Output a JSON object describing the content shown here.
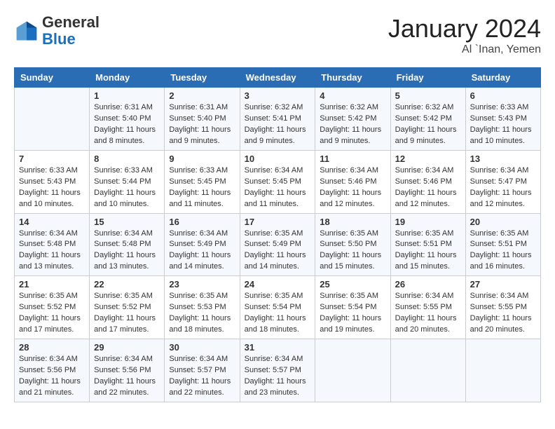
{
  "header": {
    "logo_general": "General",
    "logo_blue": "Blue",
    "month": "January 2024",
    "location": "Al `Inan, Yemen"
  },
  "columns": [
    "Sunday",
    "Monday",
    "Tuesday",
    "Wednesday",
    "Thursday",
    "Friday",
    "Saturday"
  ],
  "weeks": [
    [
      {
        "day": "",
        "info": ""
      },
      {
        "day": "1",
        "info": "Sunrise: 6:31 AM\nSunset: 5:40 PM\nDaylight: 11 hours\nand 8 minutes."
      },
      {
        "day": "2",
        "info": "Sunrise: 6:31 AM\nSunset: 5:40 PM\nDaylight: 11 hours\nand 9 minutes."
      },
      {
        "day": "3",
        "info": "Sunrise: 6:32 AM\nSunset: 5:41 PM\nDaylight: 11 hours\nand 9 minutes."
      },
      {
        "day": "4",
        "info": "Sunrise: 6:32 AM\nSunset: 5:42 PM\nDaylight: 11 hours\nand 9 minutes."
      },
      {
        "day": "5",
        "info": "Sunrise: 6:32 AM\nSunset: 5:42 PM\nDaylight: 11 hours\nand 9 minutes."
      },
      {
        "day": "6",
        "info": "Sunrise: 6:33 AM\nSunset: 5:43 PM\nDaylight: 11 hours\nand 10 minutes."
      }
    ],
    [
      {
        "day": "7",
        "info": "Sunrise: 6:33 AM\nSunset: 5:43 PM\nDaylight: 11 hours\nand 10 minutes."
      },
      {
        "day": "8",
        "info": "Sunrise: 6:33 AM\nSunset: 5:44 PM\nDaylight: 11 hours\nand 10 minutes."
      },
      {
        "day": "9",
        "info": "Sunrise: 6:33 AM\nSunset: 5:45 PM\nDaylight: 11 hours\nand 11 minutes."
      },
      {
        "day": "10",
        "info": "Sunrise: 6:34 AM\nSunset: 5:45 PM\nDaylight: 11 hours\nand 11 minutes."
      },
      {
        "day": "11",
        "info": "Sunrise: 6:34 AM\nSunset: 5:46 PM\nDaylight: 11 hours\nand 12 minutes."
      },
      {
        "day": "12",
        "info": "Sunrise: 6:34 AM\nSunset: 5:46 PM\nDaylight: 11 hours\nand 12 minutes."
      },
      {
        "day": "13",
        "info": "Sunrise: 6:34 AM\nSunset: 5:47 PM\nDaylight: 11 hours\nand 12 minutes."
      }
    ],
    [
      {
        "day": "14",
        "info": "Sunrise: 6:34 AM\nSunset: 5:48 PM\nDaylight: 11 hours\nand 13 minutes."
      },
      {
        "day": "15",
        "info": "Sunrise: 6:34 AM\nSunset: 5:48 PM\nDaylight: 11 hours\nand 13 minutes."
      },
      {
        "day": "16",
        "info": "Sunrise: 6:34 AM\nSunset: 5:49 PM\nDaylight: 11 hours\nand 14 minutes."
      },
      {
        "day": "17",
        "info": "Sunrise: 6:35 AM\nSunset: 5:49 PM\nDaylight: 11 hours\nand 14 minutes."
      },
      {
        "day": "18",
        "info": "Sunrise: 6:35 AM\nSunset: 5:50 PM\nDaylight: 11 hours\nand 15 minutes."
      },
      {
        "day": "19",
        "info": "Sunrise: 6:35 AM\nSunset: 5:51 PM\nDaylight: 11 hours\nand 15 minutes."
      },
      {
        "day": "20",
        "info": "Sunrise: 6:35 AM\nSunset: 5:51 PM\nDaylight: 11 hours\nand 16 minutes."
      }
    ],
    [
      {
        "day": "21",
        "info": "Sunrise: 6:35 AM\nSunset: 5:52 PM\nDaylight: 11 hours\nand 17 minutes."
      },
      {
        "day": "22",
        "info": "Sunrise: 6:35 AM\nSunset: 5:52 PM\nDaylight: 11 hours\nand 17 minutes."
      },
      {
        "day": "23",
        "info": "Sunrise: 6:35 AM\nSunset: 5:53 PM\nDaylight: 11 hours\nand 18 minutes."
      },
      {
        "day": "24",
        "info": "Sunrise: 6:35 AM\nSunset: 5:54 PM\nDaylight: 11 hours\nand 18 minutes."
      },
      {
        "day": "25",
        "info": "Sunrise: 6:35 AM\nSunset: 5:54 PM\nDaylight: 11 hours\nand 19 minutes."
      },
      {
        "day": "26",
        "info": "Sunrise: 6:34 AM\nSunset: 5:55 PM\nDaylight: 11 hours\nand 20 minutes."
      },
      {
        "day": "27",
        "info": "Sunrise: 6:34 AM\nSunset: 5:55 PM\nDaylight: 11 hours\nand 20 minutes."
      }
    ],
    [
      {
        "day": "28",
        "info": "Sunrise: 6:34 AM\nSunset: 5:56 PM\nDaylight: 11 hours\nand 21 minutes."
      },
      {
        "day": "29",
        "info": "Sunrise: 6:34 AM\nSunset: 5:56 PM\nDaylight: 11 hours\nand 22 minutes."
      },
      {
        "day": "30",
        "info": "Sunrise: 6:34 AM\nSunset: 5:57 PM\nDaylight: 11 hours\nand 22 minutes."
      },
      {
        "day": "31",
        "info": "Sunrise: 6:34 AM\nSunset: 5:57 PM\nDaylight: 11 hours\nand 23 minutes."
      },
      {
        "day": "",
        "info": ""
      },
      {
        "day": "",
        "info": ""
      },
      {
        "day": "",
        "info": ""
      }
    ]
  ]
}
